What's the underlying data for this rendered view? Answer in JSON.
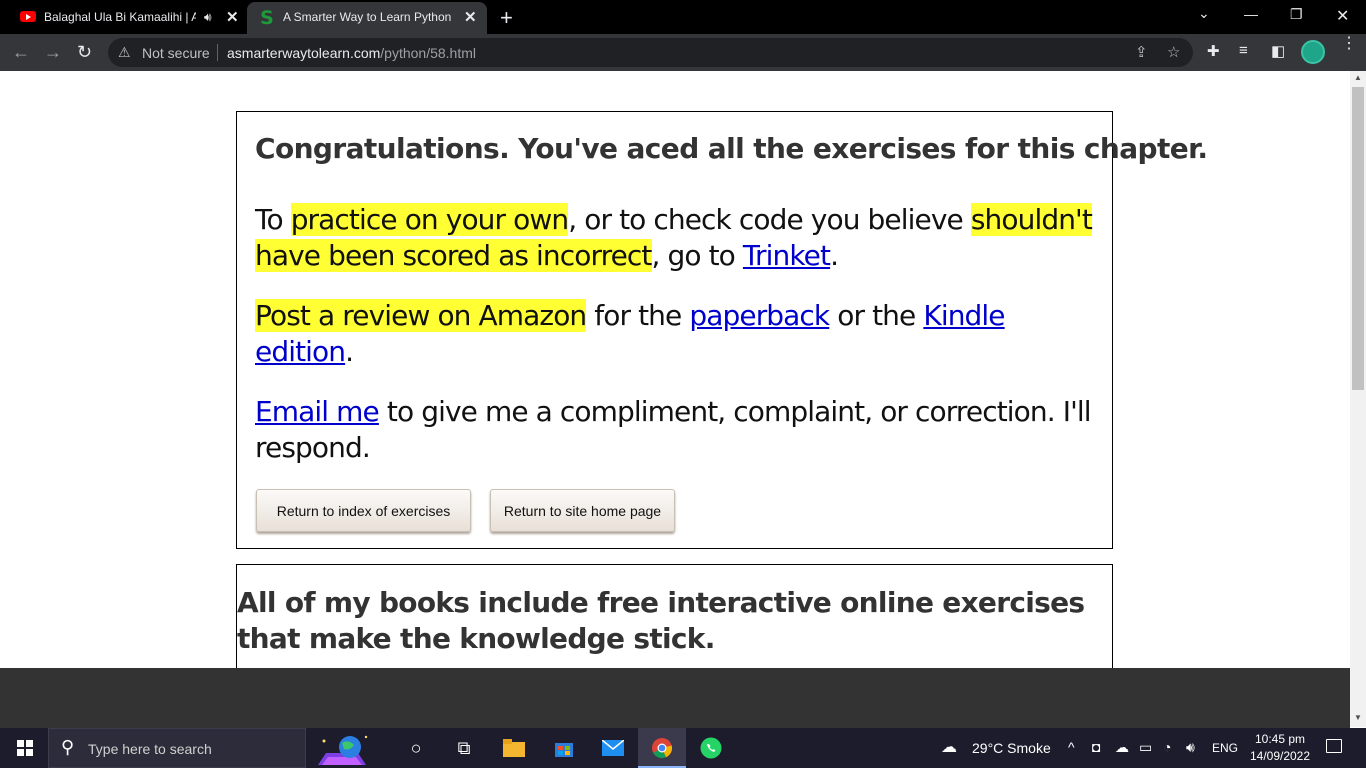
{
  "browser": {
    "tabs": [
      {
        "title": "Balaghal Ula Bi Kamaalihi | A",
        "favicon": "youtube-icon",
        "playing_audio": true,
        "active": false
      },
      {
        "title": "A Smarter Way to Learn Python -",
        "favicon": "s-logo-icon",
        "active": true
      }
    ],
    "address": {
      "security_label": "Not secure",
      "host": "asmarterwaytolearn.com",
      "path": "/python/58.html"
    }
  },
  "page": {
    "heading": "Congratulations. You've aced all the exercises for this chapter.",
    "para1": {
      "t1": "To ",
      "hl1": "practice on your own",
      "t2": ", or to check code you believe ",
      "hl2": "shouldn't have been scored as incorrect",
      "t3": ", go to ",
      "link": "Trinket",
      "t4": "."
    },
    "para2": {
      "hl": "Post a review on Amazon",
      "t1": " for the ",
      "link1": "paperback",
      "t2": " or the ",
      "link2": "Kindle edition",
      "t3": "."
    },
    "para3": {
      "link": "Email me",
      "t1": " to give me a compliment, complaint, or correction. I'll respond."
    },
    "buttons": {
      "index": "Return to index of exercises",
      "home": "Return to site home page"
    },
    "heading2": "All of my books include free interactive online exercises that make the knowledge stick."
  },
  "taskbar": {
    "search_placeholder": "Type here to search",
    "weather": "29°C  Smoke",
    "language": "ENG",
    "time": "10:45 pm",
    "date": "14/09/2022"
  },
  "colors": {
    "highlight": "#ffff33",
    "link": "#0000cc",
    "tab_active": "#35363a"
  }
}
